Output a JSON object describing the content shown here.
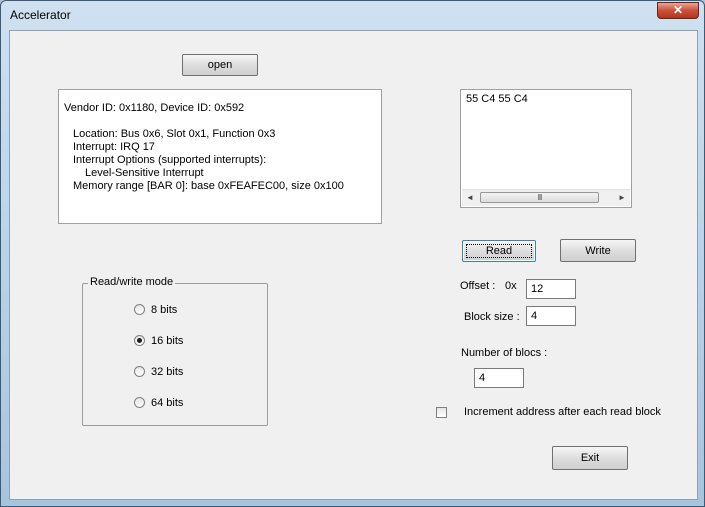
{
  "window": {
    "title": "Accelerator",
    "close_glyph": "✕"
  },
  "buttons": {
    "open": "open",
    "read": "Read",
    "write": "Write",
    "exit": "Exit"
  },
  "device_info": {
    "lines": [
      "Vendor ID: 0x1180, Device ID: 0x592",
      "Location: Bus 0x6, Slot 0x1, Function 0x3",
      "Interrupt: IRQ 17",
      "Interrupt Options (supported interrupts):",
      "Level-Sensitive Interrupt",
      "Memory range [BAR 0]: base 0xFEAFEC00, size 0x100"
    ]
  },
  "output_list": {
    "text": "55 C4 55 C4",
    "scroll_left": "◄",
    "scroll_right": "►",
    "thumb_grip": "III"
  },
  "mode_group": {
    "legend": "Read/write mode",
    "options": [
      {
        "label": "8 bits",
        "selected": false
      },
      {
        "label": "16 bits",
        "selected": true
      },
      {
        "label": "32 bits",
        "selected": false
      },
      {
        "label": "64 bits",
        "selected": false
      }
    ]
  },
  "fields": {
    "offset_label": "Offset :",
    "offset_prefix": "0x",
    "offset_value": "12",
    "block_size_label": "Block size :",
    "block_size_value": "4",
    "num_blocs_label": "Number of blocs :",
    "num_blocs_value": "4"
  },
  "increment_checkbox": {
    "label": "Increment address after each read block",
    "checked": false
  }
}
